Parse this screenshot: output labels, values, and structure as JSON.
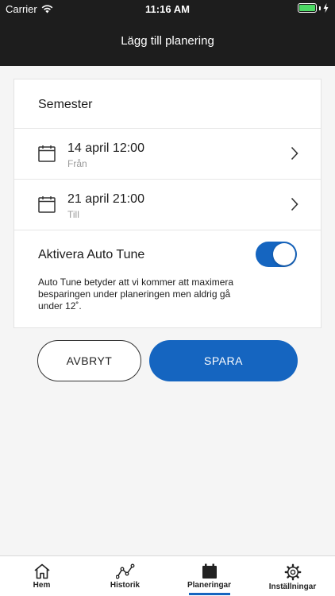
{
  "status_bar": {
    "carrier": "Carrier",
    "time": "11:16 AM",
    "battery_level": 1.0
  },
  "header": {
    "title": "Lägg till planering"
  },
  "form": {
    "name": "Semester",
    "from": {
      "date": "14 april 12:00",
      "label": "Från"
    },
    "to": {
      "date": "21 april 21:00",
      "label": "Till"
    },
    "autotune": {
      "label": "Aktivera Auto Tune",
      "enabled": true,
      "description": "Auto Tune betyder att vi kommer att maximera besparingen under planeringen men aldrig gå under 12˚."
    }
  },
  "buttons": {
    "cancel": "AVBRYT",
    "save": "SPARA"
  },
  "tabs": [
    {
      "label": "Hem",
      "icon": "home-icon"
    },
    {
      "label": "Historik",
      "icon": "graph-icon"
    },
    {
      "label": "Planeringar",
      "icon": "calendar-icon",
      "active": true
    },
    {
      "label": "Inställningar",
      "icon": "gear-icon"
    }
  ],
  "colors": {
    "accent": "#1565c0",
    "header_bg": "#1d1d1d",
    "battery": "#4cd964"
  }
}
